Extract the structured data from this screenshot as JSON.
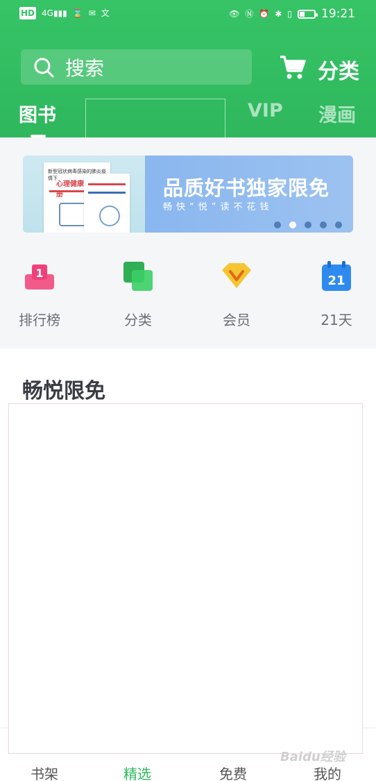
{
  "status_bar": {
    "left_icons": [
      "HD",
      "4G",
      "signal-icon",
      "hourglass-icon",
      "mail-icon",
      "translate-icon"
    ],
    "time": "19:21"
  },
  "header": {
    "search_placeholder": "搜索",
    "classify_label": "分类",
    "tabs": [
      {
        "label": "图书",
        "active": true
      },
      {
        "label": "VIP",
        "active": false
      },
      {
        "label": "漫画",
        "active": false
      }
    ]
  },
  "banner": {
    "title": "品质好书独家限免",
    "subtitle": "畅快“悦”读不花钱",
    "book_title": "心理健康 指导手册",
    "book_header": "新型冠状病毒感染的肺炎疫情下",
    "slide_count": 5,
    "active_slide": 2
  },
  "quick_entries": [
    {
      "label": "排行榜",
      "icon": "ranking-icon",
      "color": "#f0407a"
    },
    {
      "label": "分类",
      "icon": "category-icon",
      "color": "#2fbf5b"
    },
    {
      "label": "会员",
      "icon": "vip-icon",
      "color": "#f7c531"
    },
    {
      "label": "21天",
      "icon": "calendar-icon",
      "color": "#2f8af0",
      "icon_text": "21"
    }
  ],
  "section": {
    "title": "畅悦限免"
  },
  "bottom_nav": [
    {
      "label": "书架",
      "active": false
    },
    {
      "label": "精选",
      "active": true
    },
    {
      "label": "免费",
      "active": false
    },
    {
      "label": "我的",
      "active": false
    }
  ],
  "watermark": "Baidu经验",
  "colors": {
    "brand_green": "#2fb75d",
    "banner_blue": "#8cb8ef"
  }
}
